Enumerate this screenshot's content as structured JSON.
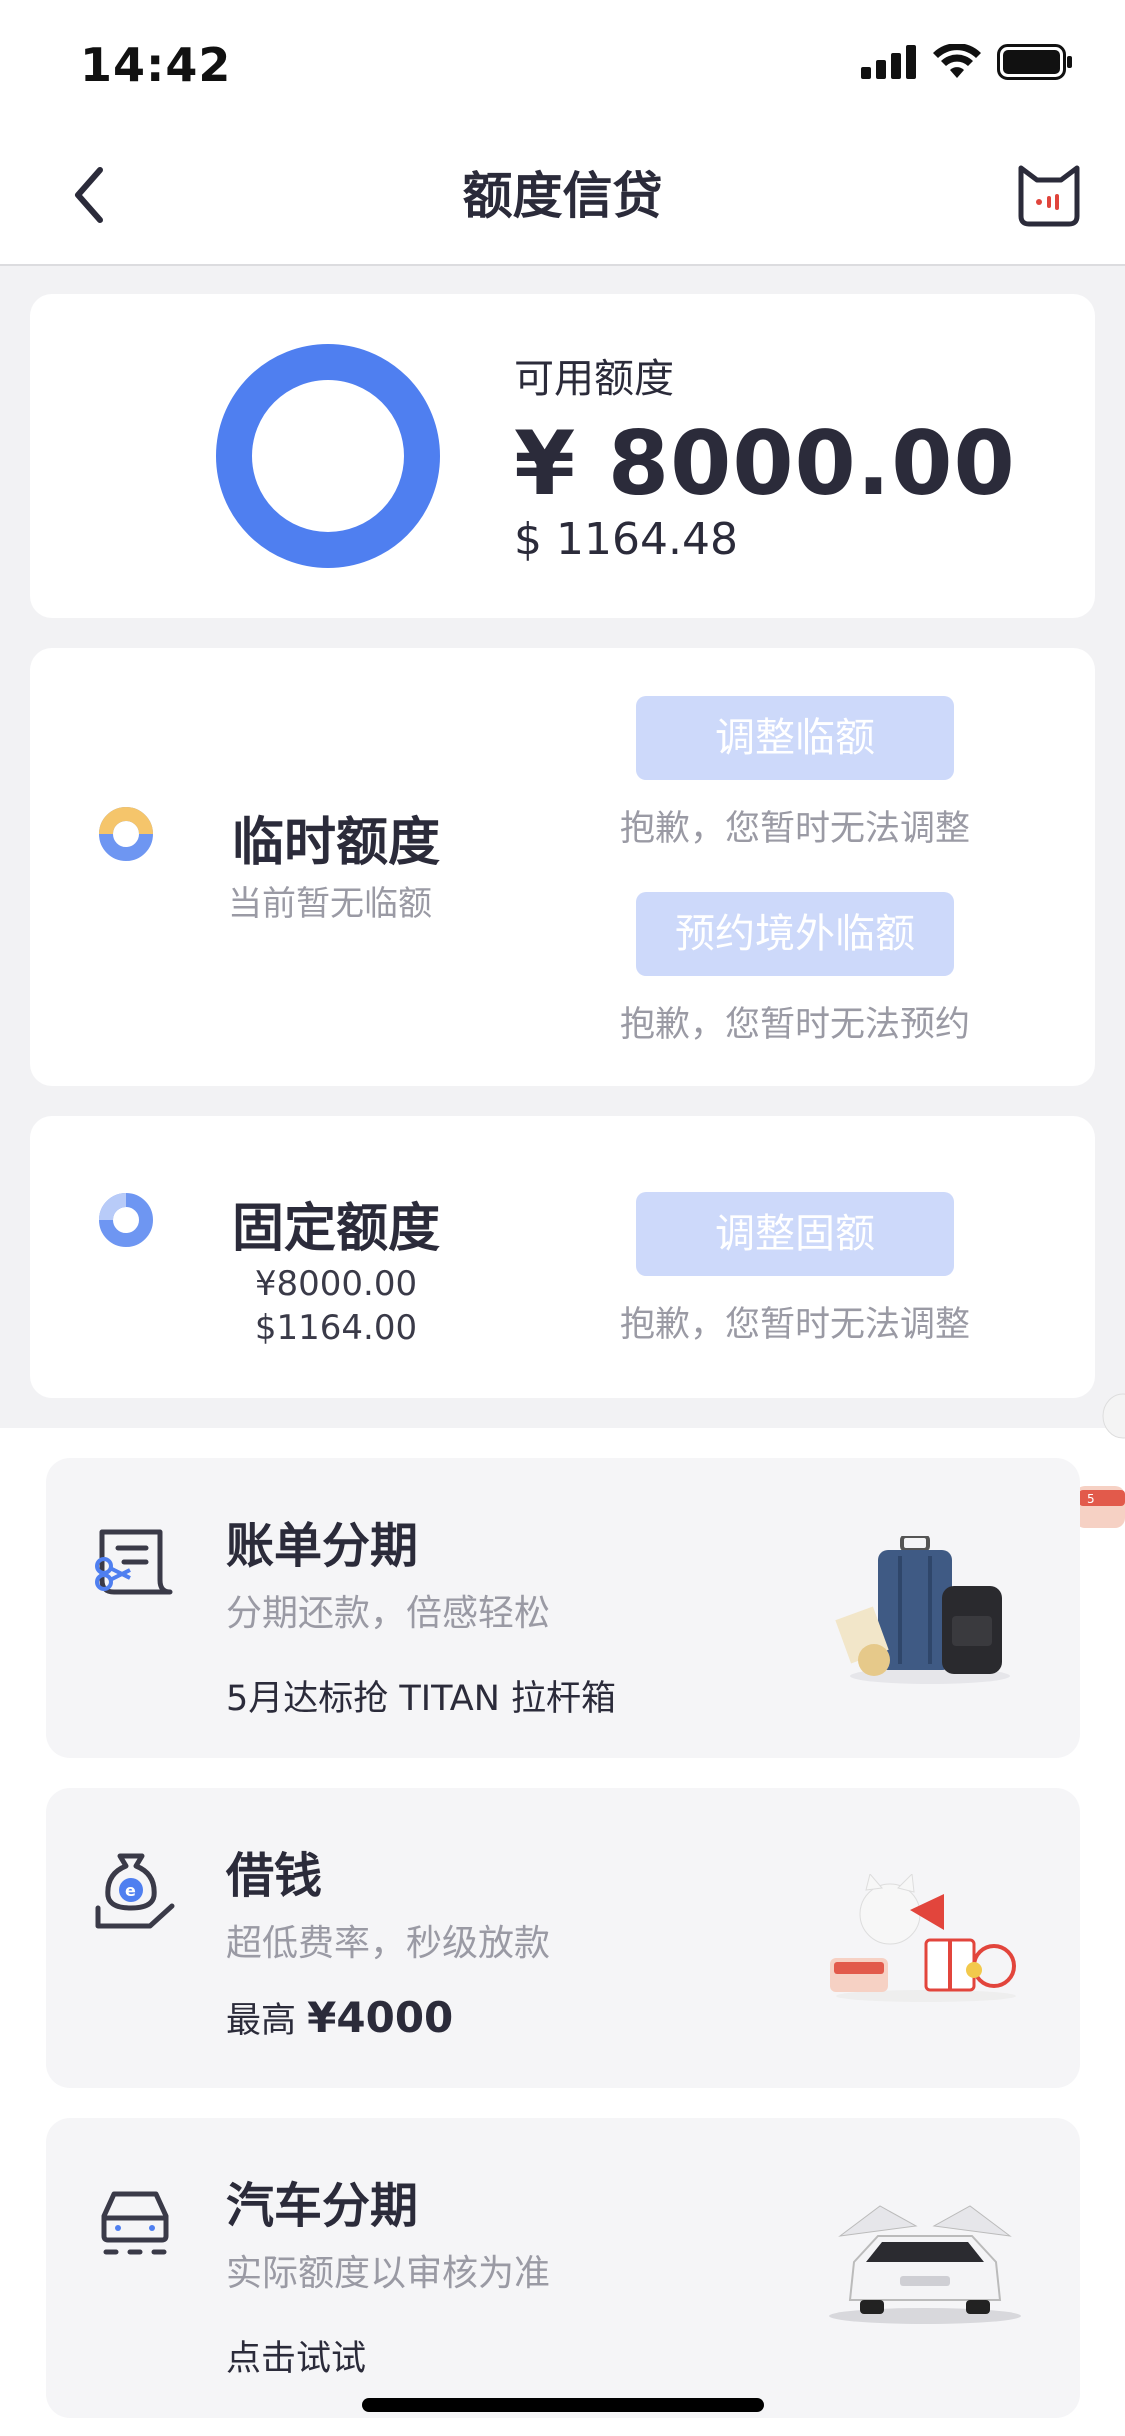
{
  "status_bar": {
    "time": "14:42"
  },
  "nav": {
    "title": "额度信贷",
    "back_icon": "chevron-left-icon",
    "mascot_icon": "cat-mascot-icon"
  },
  "available": {
    "label": "可用额度",
    "amount_cny": "¥ 8000.00",
    "amount_usd": "$ 1164.48",
    "ring_color": "#4f7ff0"
  },
  "temp_quota": {
    "title": "临时额度",
    "subtitle": "当前暂无临额",
    "adjust_button": "调整临额",
    "adjust_hint": "抱歉，您暂时无法调整",
    "reserve_button": "预约境外临额",
    "reserve_hint": "抱歉，您暂时无法预约"
  },
  "fixed_quota": {
    "title": "固定额度",
    "amount_cny": "¥8000.00",
    "amount_usd": "$1164.00",
    "adjust_button": "调整固额",
    "adjust_hint": "抱歉，您暂时无法调整"
  },
  "promos": [
    {
      "title": "账单分期",
      "subtitle": "分期还款，倍感轻松",
      "extra": "5月达标抢 TITAN 拉杆箱",
      "icon": "bill-installment-icon",
      "image": "luggage-image"
    },
    {
      "title": "借钱",
      "subtitle": "超低费率，秒级放款",
      "extra_prefix": "最高",
      "extra_amount": "¥4000",
      "icon": "money-bag-hand-icon",
      "image": "mascot-gift-image"
    },
    {
      "title": "汽车分期",
      "subtitle": "实际额度以审核为准",
      "extra": "点击试试",
      "icon": "car-icon",
      "image": "white-suv-image"
    }
  ],
  "colors": {
    "accent": "#4f7ff0",
    "button_disabled": "#cdd9fa",
    "donut_orange": "#f5c56b"
  }
}
